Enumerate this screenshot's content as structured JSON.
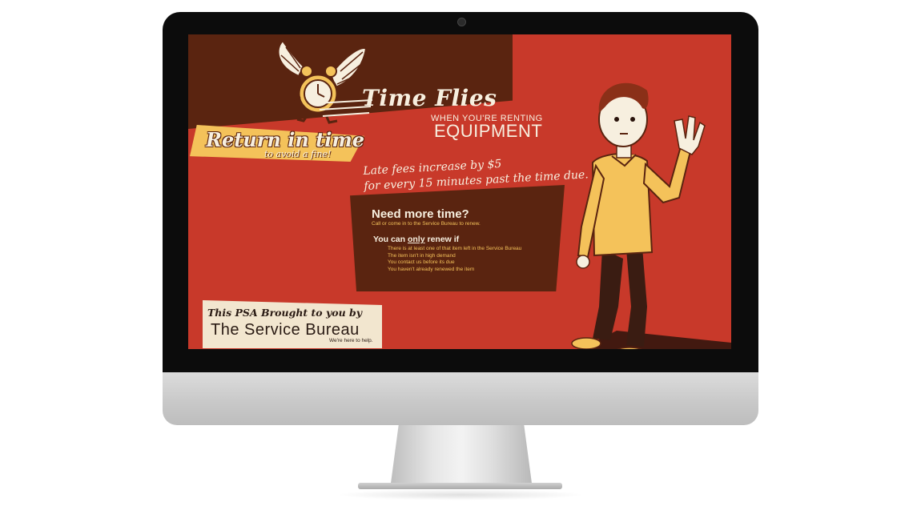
{
  "screen": {
    "title": "Time Flies",
    "subtitle_small": "WHEN YOU'RE RENTING",
    "subtitle_big": "EQUIPMENT",
    "return_title": "Return in time",
    "return_sub": "to avoid a fine!",
    "late_fee_line1": "Late fees increase by $5",
    "late_fee_line2": "for every 15 minutes past the time due.",
    "need_title": "Need more time?",
    "need_sub": "Call or come in to the Service Bureau to renew.",
    "renew_head_pre": "You can ",
    "renew_head_em": "only",
    "renew_head_post": " renew if",
    "renew_items": [
      "There is at least one of that item left in the Service Bureau",
      "The item isn't in high demand",
      "You contact us before its due",
      "You haven't already renewed the item"
    ],
    "psa_line": "This PSA Brought to you by",
    "psa_brand": "The Service Bureau",
    "psa_tag": "We're here to help."
  },
  "colors": {
    "background": "#c8392a",
    "brown": "#5a2410",
    "yellow": "#f4c25a",
    "cream": "#f7efdf"
  }
}
